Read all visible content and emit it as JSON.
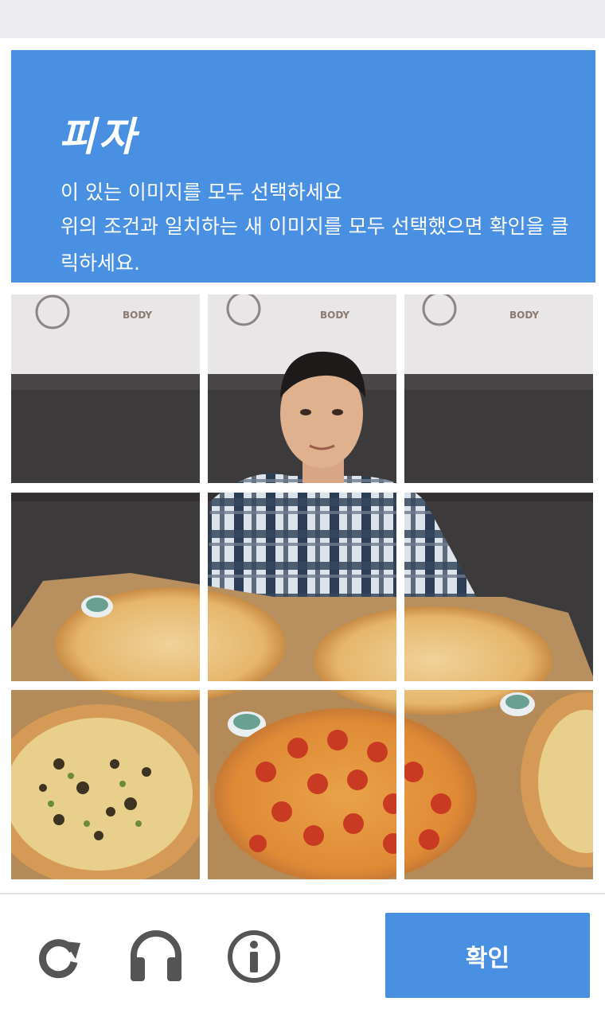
{
  "challenge": {
    "title": "피자",
    "instruction": "이 있는 이미지를 모두 선택하세요",
    "detail": "위의 조건과 일치하는 새 이미지를 모두 선택했으면 확인을 클릭하세요."
  },
  "image_grid": {
    "rows": 3,
    "cols": 3,
    "tiles": [
      {
        "content": "studio wall with logos"
      },
      {
        "content": "man's head"
      },
      {
        "content": "studio wall with logo"
      },
      {
        "content": "couch and pizza"
      },
      {
        "content": "man in plaid shirt"
      },
      {
        "content": "pizza boxes"
      },
      {
        "content": "supreme pizza"
      },
      {
        "content": "pepperoni pizza"
      },
      {
        "content": "pepperoni pizza"
      }
    ],
    "wall_logo_text": "BODY"
  },
  "footer": {
    "verify_label": "확인",
    "icons": [
      "reload-icon",
      "headphones-icon",
      "info-icon"
    ]
  },
  "colors": {
    "accent": "#4a90e2",
    "divider": "#e2e2e2",
    "icon": "#555555"
  }
}
